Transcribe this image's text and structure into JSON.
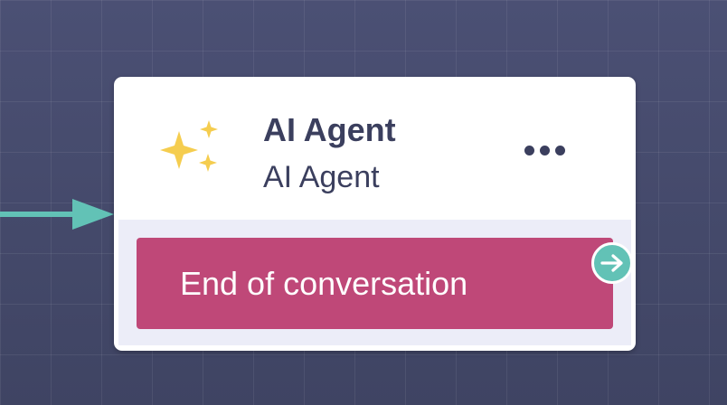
{
  "node": {
    "title": "AI Agent",
    "subtitle": "AI Agent",
    "icon": "sparkles-icon",
    "menu_icon": "more-horizontal-icon",
    "end_button_label": "End of conversation",
    "output_port_icon": "arrow-right-icon"
  },
  "colors": {
    "canvas_background": "#454a6b",
    "connector": "#62c2b6",
    "card_background": "#ffffff",
    "body_background": "#ecedf8",
    "end_button": "#bf4878",
    "sparkle": "#f5cd4f",
    "text_dark": "#3b3f5e"
  }
}
